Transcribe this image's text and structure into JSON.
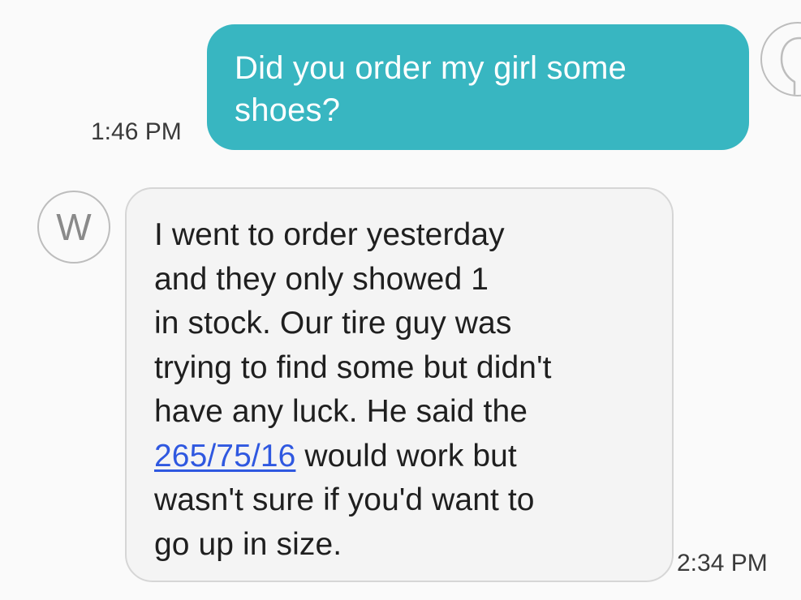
{
  "thread": {
    "outgoing": {
      "text_line1": "Did you order my girl some",
      "text_line2": "shoes?",
      "time": "1:46 PM",
      "accent_color": "#38b6c1",
      "avatar_icon": "person-silhouette-icon"
    },
    "incoming": {
      "avatar_letter": "W",
      "line1": "I went to order yesterday",
      "line2": "and they only showed 1",
      "line3": "in stock. Our tire guy was",
      "line4": "trying to find some but didn't",
      "line5": "have any luck. He said the",
      "link_text": "265/75/16",
      "line6_rest": " would work but",
      "line7": "wasn't sure if you'd want to",
      "line8": "go up in size.",
      "time": "2:34 PM",
      "link_color": "#2f58e0"
    }
  }
}
